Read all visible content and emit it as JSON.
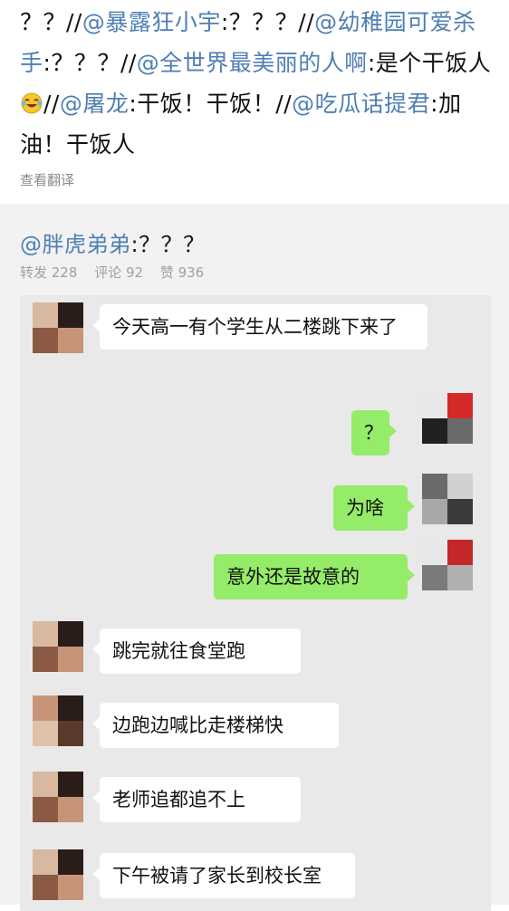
{
  "post": {
    "segments": [
      {
        "text": "？？//",
        "type": "plain"
      },
      {
        "text": "@暴露狂小宇",
        "type": "mention"
      },
      {
        "text": ":？？？//",
        "type": "plain"
      },
      {
        "text": "@幼稚园可爱杀手",
        "type": "mention"
      },
      {
        "text": ":？？？//",
        "type": "plain"
      },
      {
        "text": "@全世界最美丽的人啊",
        "type": "mention"
      },
      {
        "text": ":是个干饭人",
        "type": "plain"
      },
      {
        "text": "//",
        "type": "plain"
      },
      {
        "text": "@屠龙",
        "type": "mention"
      },
      {
        "text": ":干饭！干饭！//",
        "type": "plain"
      },
      {
        "text": "@吃瓜话提君",
        "type": "mention"
      },
      {
        "text": ":加油！干饭人",
        "type": "plain"
      }
    ],
    "emoji": "laugh-cry-emoji",
    "translate_label": "查看翻译"
  },
  "repost": {
    "author": "@胖虎弟弟",
    "text": ":？？？",
    "stats": {
      "forward": "转发 228",
      "comment": "评论 92",
      "like": "赞 936"
    }
  },
  "chat": {
    "messages": [
      {
        "side": "left",
        "text": "今天高一有个学生从二楼跳下来了"
      },
      {
        "side": "right",
        "text": "？"
      },
      {
        "side": "right",
        "text": "为啥"
      },
      {
        "side": "right",
        "text": "意外还是故意的"
      },
      {
        "side": "left",
        "text": "跳完就往食堂跑"
      },
      {
        "side": "left",
        "text": "边跑边喊比走楼梯快"
      },
      {
        "side": "left",
        "text": "老师追都追不上"
      },
      {
        "side": "left",
        "text": "下午被请了家长到校长室"
      }
    ]
  },
  "colors": {
    "mention": "#4f7fb3",
    "bubble_right": "#95ec69",
    "bubble_left": "#ffffff",
    "repost_bg": "#f2f2f2",
    "chat_bg": "#e9e9e9"
  }
}
